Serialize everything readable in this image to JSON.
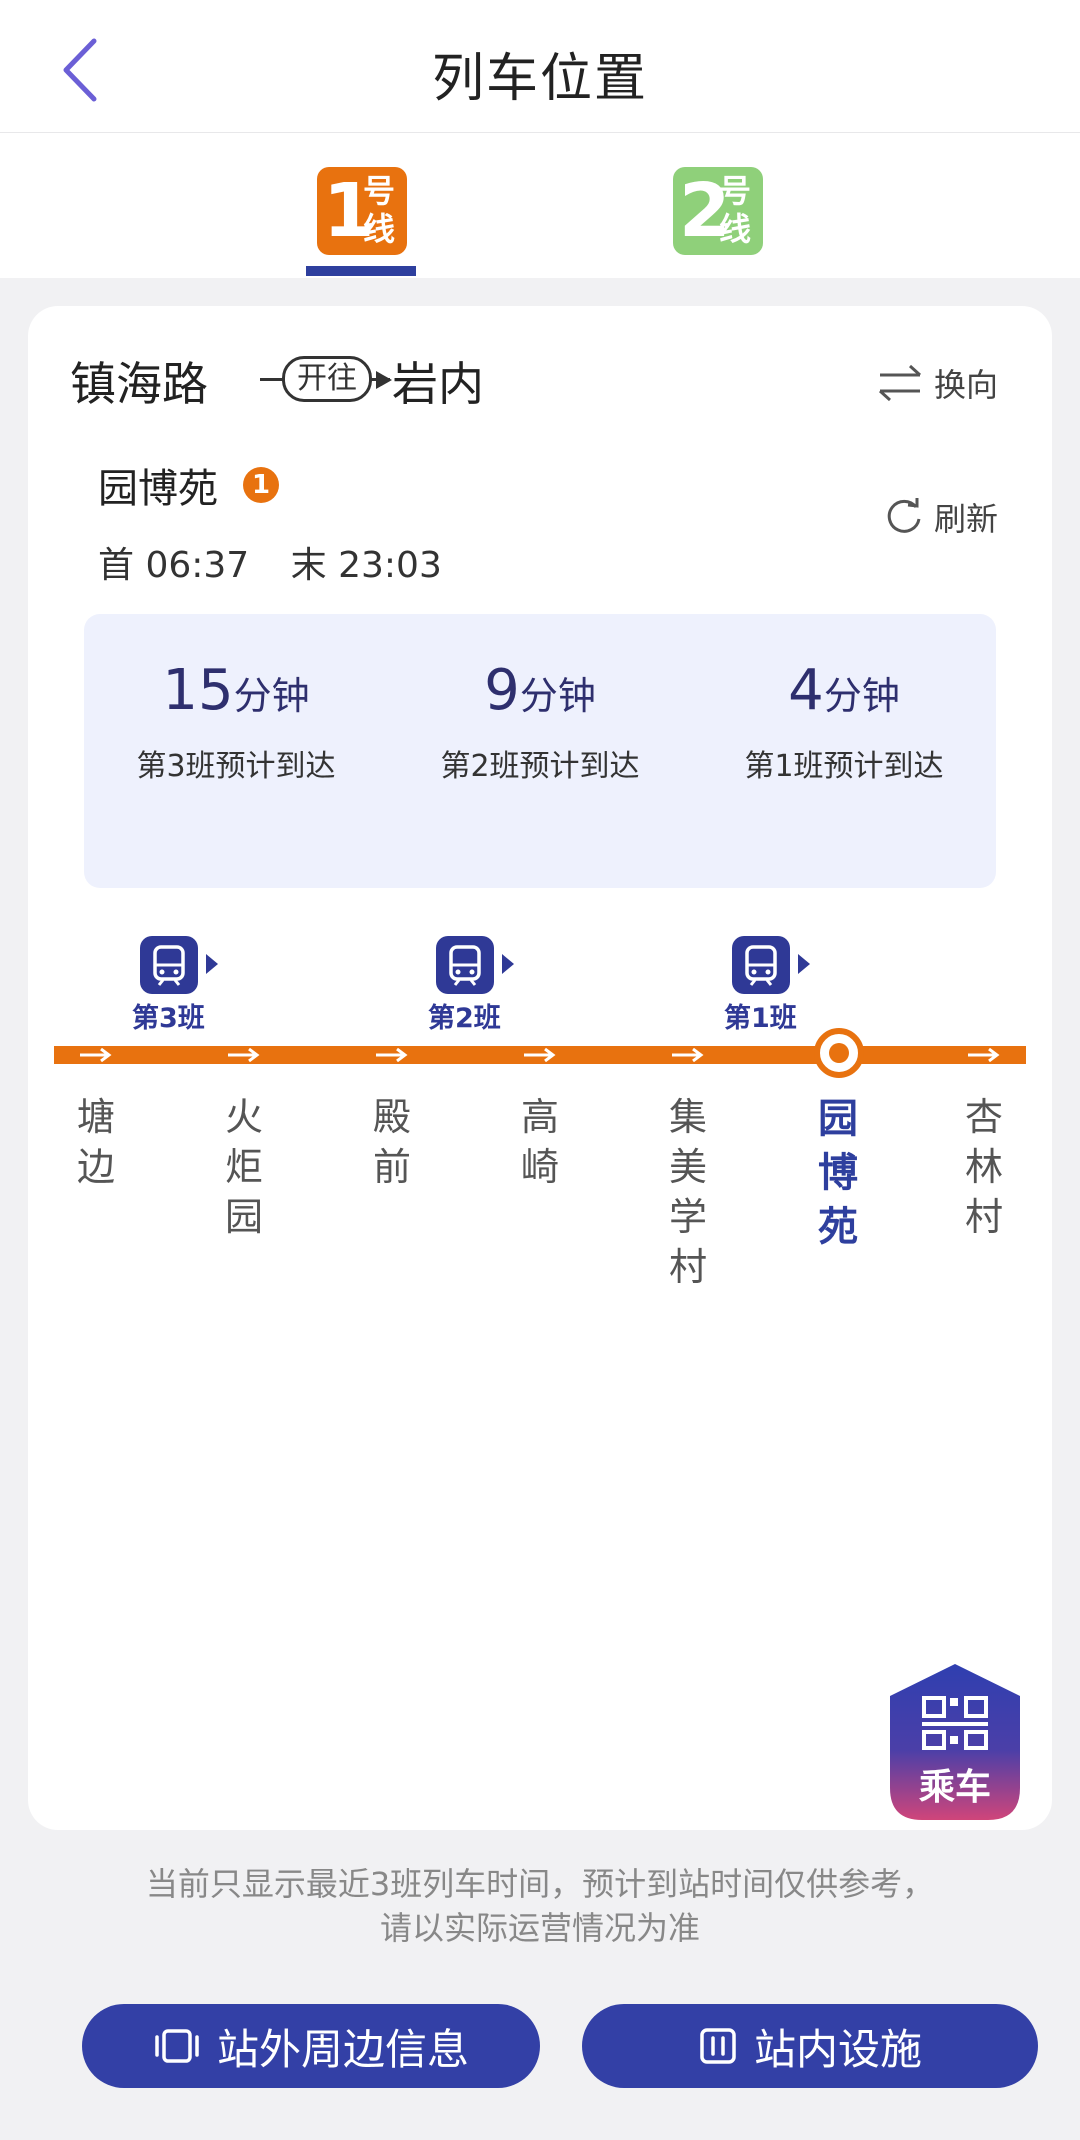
{
  "header": {
    "title": "列车位置"
  },
  "tabs": [
    {
      "number": "1",
      "hao": "号",
      "xian": "线",
      "active": true,
      "color": "#e8720f"
    },
    {
      "number": "2",
      "hao": "号",
      "xian": "线",
      "active": false,
      "color": "#8fd07a"
    }
  ],
  "direction": {
    "from": "镇海路",
    "toward_label": "开往",
    "to": "岩内",
    "switch_label": "换向"
  },
  "station": {
    "name": "园博苑",
    "line_badge": "1",
    "first": "首 06:37",
    "last": "末 23:03",
    "refresh_label": "刷新"
  },
  "arrivals": [
    {
      "minutes": "15",
      "unit": "分钟",
      "desc": "第3班预计到达"
    },
    {
      "minutes": "9",
      "unit": "分钟",
      "desc": "第2班预计到达"
    },
    {
      "minutes": "4",
      "unit": "分钟",
      "desc": "第1班预计到达"
    }
  ],
  "trains": [
    "第3班",
    "第2班",
    "第1班"
  ],
  "stations": [
    "塘边",
    "火炬园",
    "殿前",
    "高崎",
    "集美学村",
    "园博苑",
    "杏林村"
  ],
  "current_station_index": 5,
  "ride_button": {
    "label": "乘车"
  },
  "notice": {
    "line1": "当前只显示最近3班列车时间，预计到站时间仅供参考，",
    "line2": "请以实际运营情况为准"
  },
  "buttons": {
    "outside": "站外周边信息",
    "inside": "站内设施"
  },
  "colors": {
    "accent": "#3340a6",
    "line1": "#e8720f",
    "line2": "#8fd07a"
  }
}
